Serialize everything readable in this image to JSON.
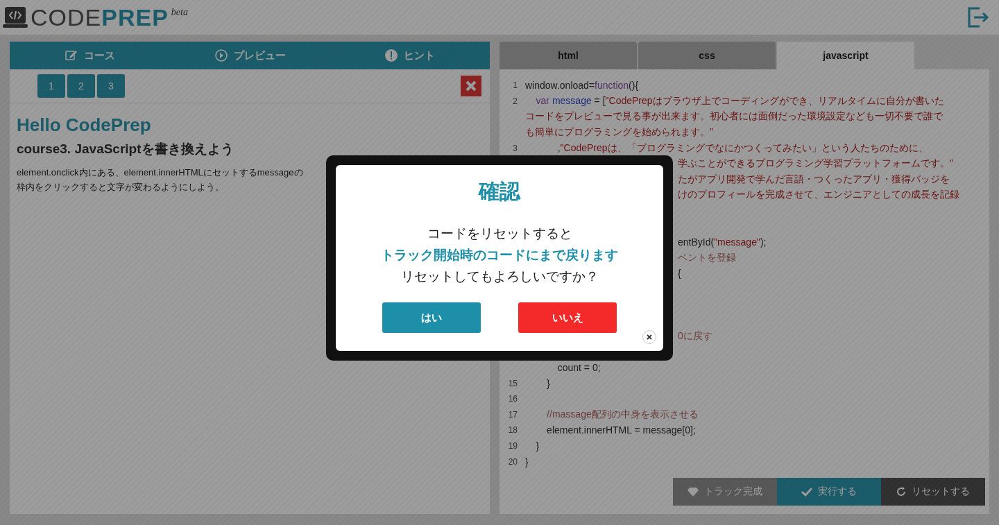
{
  "header": {
    "logo_word_1": "CODE",
    "logo_word_2": "PREP",
    "logo_badge": "beta"
  },
  "left_panel": {
    "tabs": [
      {
        "label": "コース"
      },
      {
        "label": "プレビュー"
      },
      {
        "label": "ヒント"
      }
    ],
    "pages": [
      "1",
      "2",
      "3"
    ],
    "title": "Hello CodePrep",
    "subtitle": "course3. JavaScriptを書き換えよう",
    "description": [
      "element.onclick内にある、element.innerHTMLにセットするmessageの",
      "枠内をクリックすると文字が変わるようにしよう。"
    ]
  },
  "editor": {
    "tabs": [
      {
        "label": "html",
        "selected": false
      },
      {
        "label": "css",
        "selected": false
      },
      {
        "label": "javascript",
        "selected": true
      }
    ],
    "rows": [
      {
        "kind": "full",
        "number": "1",
        "segments": [
          {
            "kind": "plain",
            "text": "window.onload="
          },
          {
            "kind": "keyword",
            "text": "function"
          },
          {
            "kind": "plain",
            "text": "(){"
          }
        ]
      },
      {
        "kind": "full",
        "number": "2",
        "segments": [
          {
            "kind": "keyword",
            "text": "    var"
          },
          {
            "kind": "variable",
            "text": " message"
          },
          {
            "kind": "plain",
            "text": " = ["
          },
          {
            "kind": "string",
            "text": "\"CodePrepはブラウザ上でコーディングができ、リアルタイムに自分が書いた"
          }
        ]
      },
      {
        "kind": "full",
        "segments": [
          {
            "kind": "string",
            "text": "コードをプレビューで見る事が出来ます。初心者には面倒だった環境設定なども一切不要で誰で"
          }
        ]
      },
      {
        "kind": "full",
        "segments": [
          {
            "kind": "string",
            "text": "も簡単にプログラミングを始められます。\""
          }
        ]
      },
      {
        "kind": "full",
        "number": "3",
        "segments": [
          {
            "kind": "plain",
            "text": "            ,"
          },
          {
            "kind": "string",
            "text": "\"CodePrepは、「プログラミングでなにかつくってみたい」という人たちのために、"
          }
        ]
      },
      {
        "kind": "tail",
        "segments": [
          {
            "kind": "string",
            "text": "学ぶことができるプログラミング学習プラットフォームです。\""
          }
        ]
      },
      {
        "kind": "tail",
        "segments": [
          {
            "kind": "string",
            "text": "たがアプリ開発で学んだ言語・つくったアプリ・獲得バッジを"
          }
        ]
      },
      {
        "kind": "tail",
        "segments": [
          {
            "kind": "string",
            "text": "けのプロフィールを完成させて、エンジニアとしての成長を記録"
          }
        ]
      },
      {
        "kind": "hidden"
      },
      {
        "kind": "hidden"
      },
      {
        "kind": "tail",
        "segments": [
          {
            "kind": "plain",
            "text": "entById("
          },
          {
            "kind": "string",
            "text": "\"message\""
          },
          {
            "kind": "plain",
            "text": ");"
          }
        ]
      },
      {
        "kind": "tail",
        "segments": [
          {
            "kind": "comment",
            "text": "ベントを登録"
          }
        ]
      },
      {
        "kind": "tail",
        "segments": [
          {
            "kind": "plain",
            "text": "{"
          }
        ]
      },
      {
        "kind": "hidden"
      },
      {
        "kind": "hidden"
      },
      {
        "kind": "hidden"
      },
      {
        "kind": "tail",
        "segments": [
          {
            "kind": "comment",
            "text": "0に戻す"
          }
        ]
      },
      {
        "kind": "hidden"
      },
      {
        "kind": "full",
        "segments": [
          {
            "kind": "plain",
            "text": "            count = 0;"
          }
        ]
      },
      {
        "kind": "full",
        "number": "15",
        "segments": [
          {
            "kind": "plain",
            "text": "        }"
          }
        ]
      },
      {
        "kind": "full",
        "number": "16",
        "segments": []
      },
      {
        "kind": "full",
        "number": "17",
        "segments": [
          {
            "kind": "comment",
            "text": "        //massage配列の中身を表示させる"
          }
        ]
      },
      {
        "kind": "full",
        "number": "18",
        "segments": [
          {
            "kind": "plain",
            "text": "        element.innerHTML = message[0];"
          }
        ]
      },
      {
        "kind": "full",
        "number": "19",
        "segments": [
          {
            "kind": "plain",
            "text": "    }"
          }
        ]
      },
      {
        "kind": "full",
        "number": "20",
        "segments": [
          {
            "kind": "plain",
            "text": "}"
          }
        ]
      }
    ],
    "actions": [
      {
        "label": "トラック完成",
        "kind": "complete"
      },
      {
        "label": "実行する",
        "kind": "run"
      },
      {
        "label": "リセットする",
        "kind": "reset"
      }
    ]
  },
  "dialog": {
    "title": "確認",
    "message_lines": [
      {
        "text": "コードをリセットすると",
        "emphasis": false
      },
      {
        "text": "トラック開始時のコードにまで戻ります",
        "emphasis": true
      },
      {
        "text": "リセットしてもよろしいですか？",
        "emphasis": false
      }
    ],
    "buttons": [
      {
        "label": "はい",
        "kind": "confirm"
      },
      {
        "label": "いいえ",
        "kind": "cancel"
      }
    ]
  }
}
